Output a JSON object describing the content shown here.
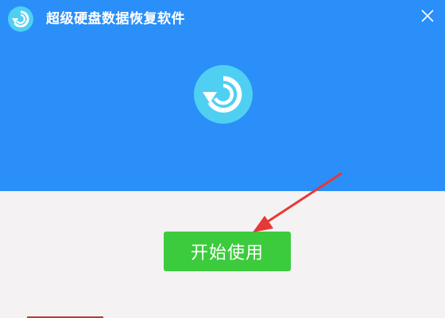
{
  "window": {
    "title": "超级硬盘数据恢复软件",
    "close_icon": "close-icon",
    "app_icon": "restore-logo-icon"
  },
  "main": {
    "logo_icon": "restore-logo-icon",
    "start_button_label": "开始使用"
  },
  "annotation": {
    "arrow_icon": "red-arrow-icon"
  },
  "colors": {
    "header_blue": "#2a8ff9",
    "logo_cyan": "#4fd0f2",
    "button_green": "#3ccb3c",
    "body_bg": "#f4f2f3",
    "arrow_red": "#e53935"
  }
}
